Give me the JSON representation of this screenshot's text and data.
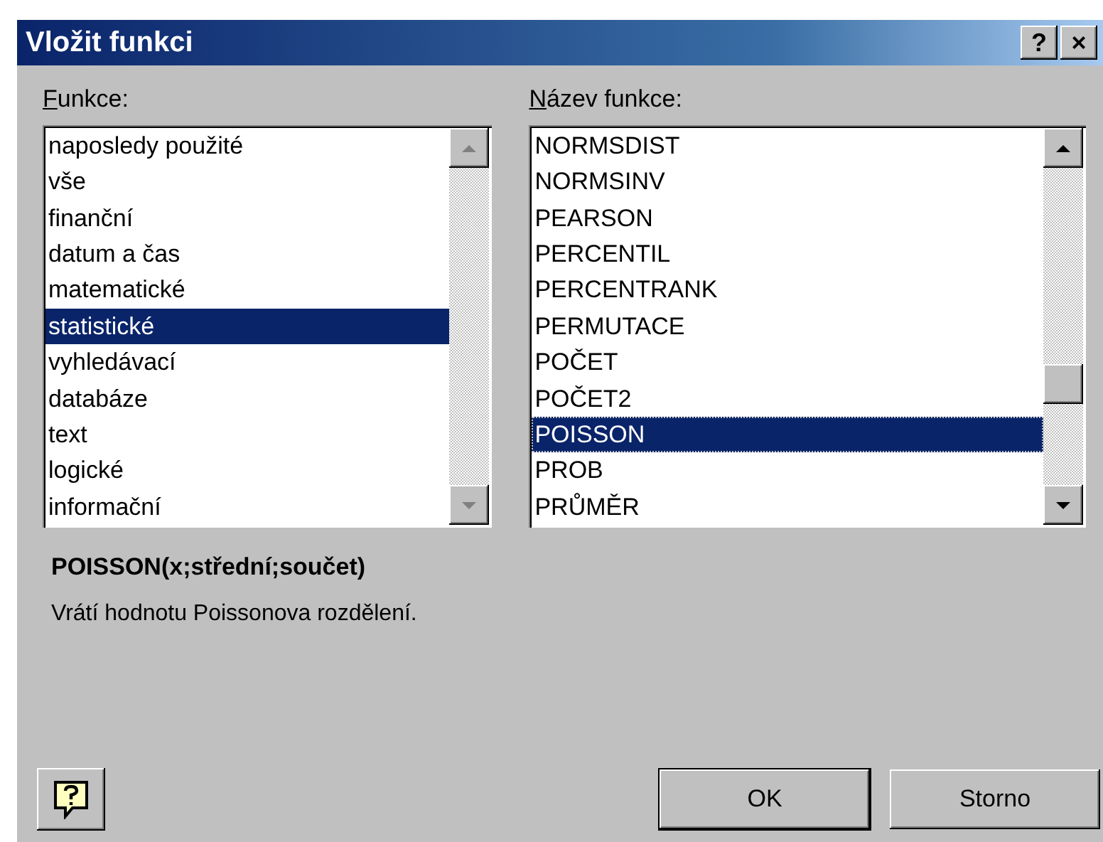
{
  "window": {
    "title": "Vložit funkci"
  },
  "title_buttons": [
    "?",
    "×"
  ],
  "categories": {
    "label": "Funkce:",
    "items": [
      {
        "label": "naposledy použité",
        "selected": false
      },
      {
        "label": "vše",
        "selected": false
      },
      {
        "label": "finanční",
        "selected": false
      },
      {
        "label": "datum a čas",
        "selected": false
      },
      {
        "label": "matematické",
        "selected": false
      },
      {
        "label": "statistické",
        "selected": true
      },
      {
        "label": "vyhledávací",
        "selected": false
      },
      {
        "label": "databáze",
        "selected": false
      },
      {
        "label": "text",
        "selected": false
      },
      {
        "label": "logické",
        "selected": false
      },
      {
        "label": "informační",
        "selected": false
      }
    ]
  },
  "functions": {
    "label": "Název funkce:",
    "items": [
      {
        "label": "NORMSDIST",
        "selected": false
      },
      {
        "label": "NORMSINV",
        "selected": false
      },
      {
        "label": "PEARSON",
        "selected": false
      },
      {
        "label": "PERCENTIL",
        "selected": false
      },
      {
        "label": "PERCENTRANK",
        "selected": false
      },
      {
        "label": "PERMUTACE",
        "selected": false
      },
      {
        "label": "POČET",
        "selected": false
      },
      {
        "label": "POČET2",
        "selected": false
      },
      {
        "label": "POISSON",
        "selected": true
      },
      {
        "label": "PROB",
        "selected": false
      },
      {
        "label": "PRŮMĚR",
        "selected": false
      }
    ]
  },
  "syntax": "POISSON(x;střední;součet)",
  "description": "Vrátí hodnotu Poissonova rozdělení.",
  "buttons": [
    "OK",
    "Storno"
  ]
}
